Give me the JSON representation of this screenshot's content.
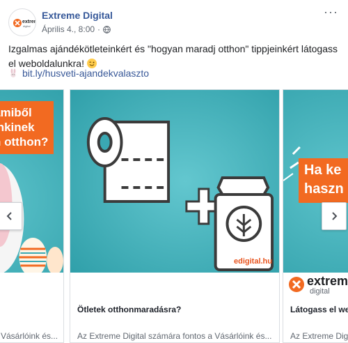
{
  "post": {
    "page_name": "Extreme Digital",
    "timestamp": "Április 4., 8:00",
    "privacy_separator": "·",
    "text": "Izgalmas ajándékötleteinkért és \"hogyan maradj otthon\" tippjeinkért látogass el weboldalunkra!",
    "link": "bit.ly/husveti-ajandekvalaszto"
  },
  "logo": {
    "word": "extreme",
    "sub": "digital"
  },
  "carousel": {
    "cards": [
      {
        "banner_lines": [
          "amiből",
          "inkinek",
          "n otthon?"
        ],
        "title": "",
        "description": "Vásárlóink és..."
      },
      {
        "brand_tag": "edigital.hu",
        "title": "Ötletek otthonmaradásra?",
        "description": "Az Extreme Digital számára fontos a Vásárlóink és..."
      },
      {
        "banner_lines": [
          "Ha ke",
          "haszn"
        ],
        "logo_word": "extreme",
        "logo_sub": "digital",
        "title": "Látogass el wel",
        "description": "Az Extreme Digital"
      }
    ]
  },
  "colors": {
    "teal": "#3aa8b3",
    "orange": "#f26a21",
    "link_blue": "#385898"
  }
}
